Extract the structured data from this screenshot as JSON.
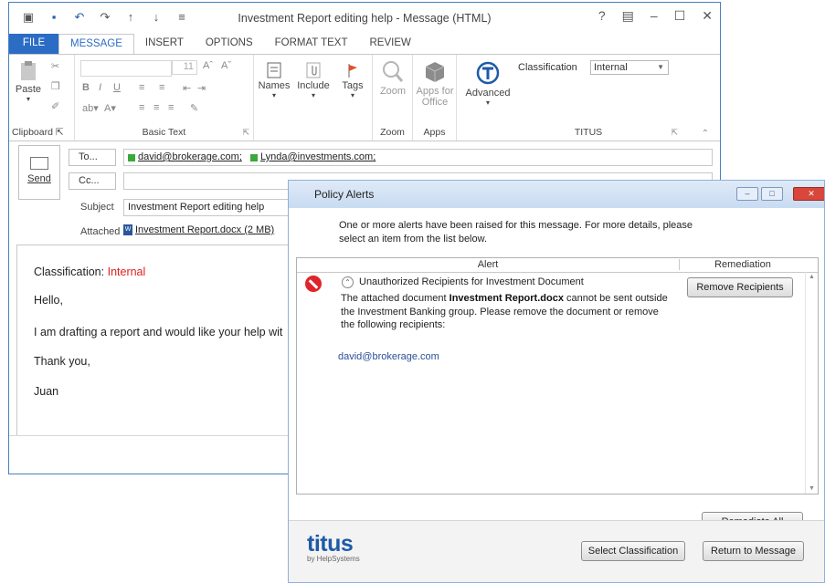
{
  "window": {
    "title": "Investment Report editing help - Message (HTML)",
    "help_glyph": "?"
  },
  "tabs": [
    "FILE",
    "MESSAGE",
    "INSERT",
    "OPTIONS",
    "FORMAT TEXT",
    "REVIEW"
  ],
  "ribbon": {
    "paste": "Paste",
    "font_size": "11",
    "names": "Names",
    "include": "Include",
    "tags": "Tags",
    "zoom": "Zoom",
    "apps_line1": "Apps for",
    "apps_line2": "Office",
    "advanced": "Advanced",
    "classification_label": "Classification",
    "classification_value": "Internal",
    "groups": {
      "clipboard": "Clipboard",
      "basic_text": "Basic Text",
      "zoom": "Zoom",
      "apps": "Apps",
      "titus": "TITUS"
    }
  },
  "compose": {
    "send": "Send",
    "to_label": "To...",
    "cc_label": "Cc...",
    "subject_label": "Subject",
    "attached_label": "Attached",
    "recipients": [
      "david@brokerage.com;",
      "Lynda@investments.com;"
    ],
    "subject": "Investment Report editing help",
    "attachment": "Investment Report.docx (2 MB)"
  },
  "body": {
    "classification_prefix": "Classification: ",
    "classification_value": "Internal",
    "greeting": "Hello,",
    "line1": "I am drafting a report and would like your help wit",
    "thanks": "Thank you,",
    "signature": "Juan"
  },
  "dialog": {
    "title": "Policy Alerts",
    "message": "One or more alerts have been raised for this message. For more details, please select an item from the list below.",
    "col_alert": "Alert",
    "col_remediation": "Remediation",
    "alert_title": "Unauthorized Recipients for Investment Document",
    "desc_before": "The attached document ",
    "desc_doc": "Investment Report.docx",
    "desc_after": " cannot be sent outside the Investment Banking group. Please remove the document or remove the following recipients:",
    "alert_email": "david@brokerage.com",
    "remove_recipients": "Remove Recipients",
    "remediate_all": "Remediate All",
    "select_classification": "Select Classification",
    "return_to_message": "Return to Message",
    "logo": "titus",
    "logo_sub": "by HelpSystems"
  }
}
